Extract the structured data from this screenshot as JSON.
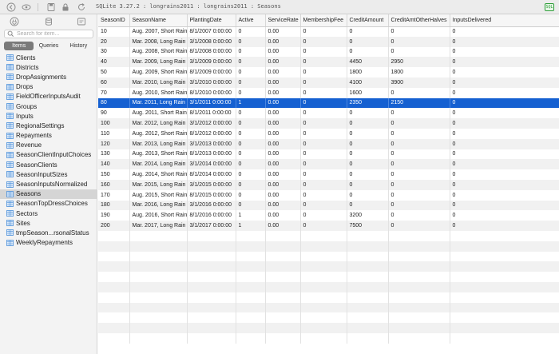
{
  "titlebar": {
    "title": "SQLite 3.27.2 : longrains2011 : longrains2011 : Seasons",
    "badge": "SQL",
    "colors": {
      "accent": "#1560d1",
      "badge": "#2f9e3a"
    }
  },
  "sidebar": {
    "search_placeholder": "Search for item...",
    "tabs": [
      {
        "label": "Items",
        "active": true
      },
      {
        "label": "Queries",
        "active": false
      },
      {
        "label": "History",
        "active": false
      }
    ],
    "items": [
      {
        "label": "Clients"
      },
      {
        "label": "Districts"
      },
      {
        "label": "DropAssignments"
      },
      {
        "label": "Drops"
      },
      {
        "label": "FieldOfficerInputsAudit"
      },
      {
        "label": "Groups"
      },
      {
        "label": "Inputs"
      },
      {
        "label": "RegionalSettings"
      },
      {
        "label": "Repayments"
      },
      {
        "label": "Revenue"
      },
      {
        "label": "SeasonClientInputChoices"
      },
      {
        "label": "SeasonClients"
      },
      {
        "label": "SeasonInputSizes"
      },
      {
        "label": "SeasonInputsNormalized"
      },
      {
        "label": "Seasons",
        "selected": true
      },
      {
        "label": "SeasonTopDressChoices"
      },
      {
        "label": "Sectors"
      },
      {
        "label": "Sites"
      },
      {
        "label": "tmpSeason...rsonalStatus"
      },
      {
        "label": "WeeklyRepayments"
      }
    ]
  },
  "table": {
    "columns": [
      "SeasonID",
      "SeasonName",
      "PlantingDate",
      "Active",
      "ServiceRate",
      "MembershipFee",
      "CreditAmount",
      "CreditAmtOtherHalves",
      "InputsDelivered"
    ],
    "rows": [
      [
        "10",
        "Aug. 2007, Short Rain",
        "8/1/2007 0:00:00",
        "0",
        "0.00",
        "0",
        "0",
        "0",
        "0"
      ],
      [
        "20",
        "Mar. 2008, Long Rain",
        "3/1/2008 0:00:00",
        "0",
        "0.00",
        "0",
        "0",
        "0",
        "0"
      ],
      [
        "30",
        "Aug. 2008, Short Rain",
        "8/1/2008 0:00:00",
        "0",
        "0.00",
        "0",
        "0",
        "0",
        "0"
      ],
      [
        "40",
        "Mar. 2009, Long Rain",
        "3/1/2009 0:00:00",
        "0",
        "0.00",
        "0",
        "4450",
        "2950",
        "0"
      ],
      [
        "50",
        "Aug. 2009, Short Rain",
        "8/1/2009 0:00:00",
        "0",
        "0.00",
        "0",
        "1800",
        "1800",
        "0"
      ],
      [
        "60",
        "Mar. 2010, Long Rain",
        "3/1/2010 0:00:00",
        "0",
        "0.00",
        "0",
        "4100",
        "3900",
        "0"
      ],
      [
        "70",
        "Aug. 2010, Short Rain",
        "8/1/2010 0:00:00",
        "0",
        "0.00",
        "0",
        "1600",
        "0",
        "0"
      ],
      [
        "80",
        "Mar. 2011, Long Rain",
        "3/1/2011 0:00:00",
        "1",
        "0.00",
        "0",
        "2350",
        "2150",
        "0"
      ],
      [
        "90",
        "Aug. 2011, Short Rain",
        "8/1/2011 0:00:00",
        "0",
        "0.00",
        "0",
        "0",
        "0",
        "0"
      ],
      [
        "100",
        "Mar. 2012, Long Rain",
        "3/1/2012 0:00:00",
        "0",
        "0.00",
        "0",
        "0",
        "0",
        "0"
      ],
      [
        "110",
        "Aug. 2012, Short Rain",
        "8/1/2012 0:00:00",
        "0",
        "0.00",
        "0",
        "0",
        "0",
        "0"
      ],
      [
        "120",
        "Mar. 2013, Long Rain",
        "3/1/2013 0:00:00",
        "0",
        "0.00",
        "0",
        "0",
        "0",
        "0"
      ],
      [
        "130",
        "Aug. 2013, Short Rain",
        "8/1/2013 0:00:00",
        "0",
        "0.00",
        "0",
        "0",
        "0",
        "0"
      ],
      [
        "140",
        "Mar. 2014, Long Rain",
        "3/1/2014 0:00:00",
        "0",
        "0.00",
        "0",
        "0",
        "0",
        "0"
      ],
      [
        "150",
        "Aug. 2014, Short Rain",
        "8/1/2014 0:00:00",
        "0",
        "0.00",
        "0",
        "0",
        "0",
        "0"
      ],
      [
        "160",
        "Mar. 2015, Long Rain",
        "3/1/2015 0:00:00",
        "0",
        "0.00",
        "0",
        "0",
        "0",
        "0"
      ],
      [
        "170",
        "Aug. 2015, Short Rain",
        "8/1/2015 0:00:00",
        "0",
        "0.00",
        "0",
        "0",
        "0",
        "0"
      ],
      [
        "180",
        "Mar. 2016, Long Rain",
        "3/1/2016 0:00:00",
        "0",
        "0.00",
        "0",
        "0",
        "0",
        "0"
      ],
      [
        "190",
        "Aug. 2016, Short Rain",
        "8/1/2016 0:00:00",
        "1",
        "0.00",
        "0",
        "3200",
        "0",
        "0"
      ],
      [
        "200",
        "Mar. 2017, Long Rain",
        "3/1/2017 0:00:00",
        "1",
        "0.00",
        "0",
        "7500",
        "0",
        "0"
      ]
    ],
    "selected_row": 7,
    "empty_rows": 11
  }
}
